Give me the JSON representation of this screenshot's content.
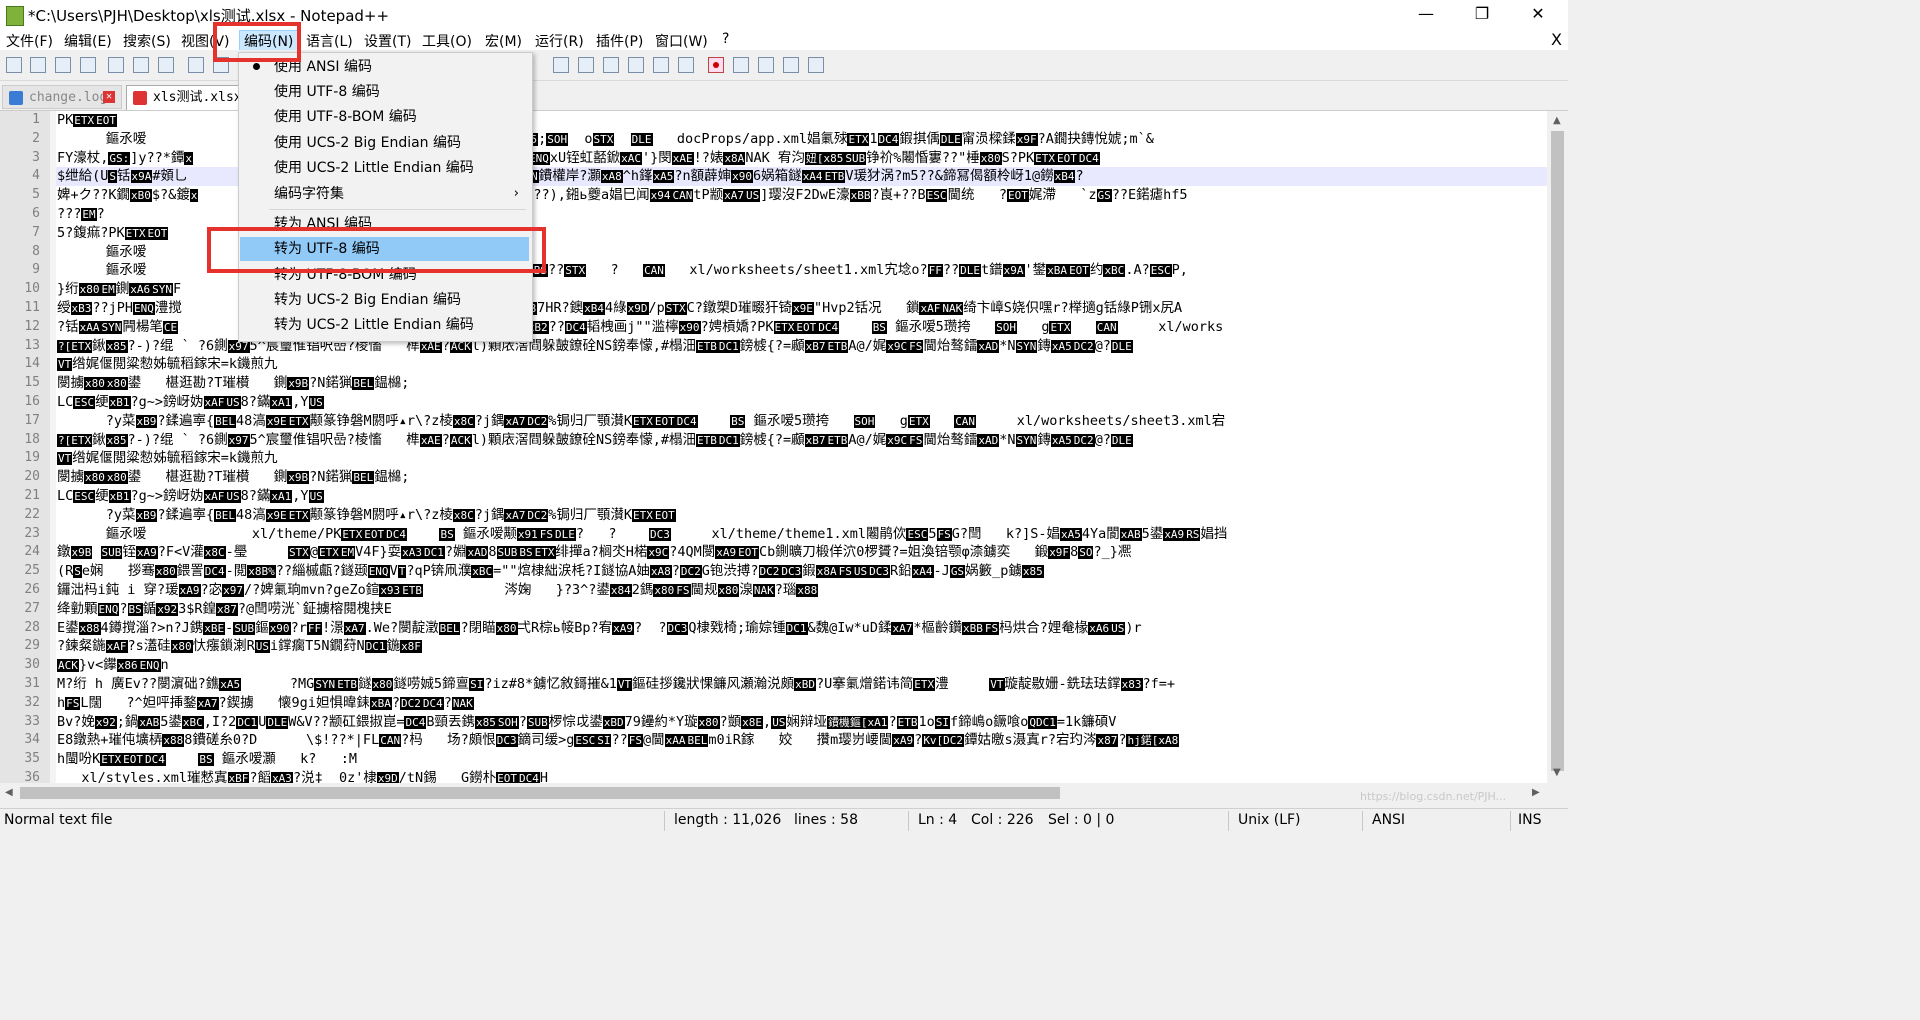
{
  "window": {
    "title": "*C:\\Users\\PJH\\Desktop\\xls测试.xlsx - Notepad++",
    "minimize": "—",
    "restore": "❐",
    "close": "✕"
  },
  "menubar": [
    "文件(F)",
    "编辑(E)",
    "搜索(S)",
    "视图(V)",
    "编码(N)",
    "语言(L)",
    "设置(T)",
    "工具(O)",
    "宏(M)",
    "运行(R)",
    "插件(P)",
    "窗口(W)",
    "?"
  ],
  "menubar_close": "X",
  "tabs": [
    {
      "label": "change.log",
      "active": false
    },
    {
      "label": "xls测试.xlsx",
      "active": true
    }
  ],
  "encoding_menu": {
    "items": [
      {
        "label": "使用 ANSI 编码",
        "checked": true
      },
      {
        "label": "使用 UTF-8 编码"
      },
      {
        "label": "使用 UTF-8-BOM 编码"
      },
      {
        "label": "使用 UCS-2 Big Endian 编码"
      },
      {
        "label": "使用 UCS-2 Little Endian 编码"
      },
      {
        "label": "编码字符集",
        "submenu": true
      },
      {
        "label": "转为 ANSI 编码"
      },
      {
        "label": "转为 UTF-8 编码",
        "highlighted": true
      },
      {
        "label": "转为 UTF-8-BOM 编码"
      },
      {
        "label": "转为 UCS-2 Big Endian 编码"
      },
      {
        "label": "转为 UCS-2 Little Endian 编码"
      }
    ],
    "submenu_arrow": "›"
  },
  "editor": {
    "line_numbers": [
      "1",
      "2",
      "3",
      "4",
      "5",
      "6",
      "7",
      "8",
      "9",
      "10",
      "11",
      "12",
      "13",
      "14",
      "15",
      "16",
      "17",
      "18",
      "19",
      "20",
      "21",
      "22",
      "23",
      "24",
      "25",
      "26",
      "27",
      "28",
      "29",
      "30",
      "31",
      "32",
      "33",
      "34",
      "35",
      "36"
    ],
    "current_line": 4,
    "lines": [
      "PK[ETX][EOT]",
      "      鏂氶嗳                                  [BS] 鏂氶嗳?y铮[xB5];[SOH]  o[STX]  [DLE]   docProps/app.xml娼氭殏[ETX]1[DC4]鍜掑偊[DLE]甯涢樑鍒[x9F]?A鐗抉鏄悅婋;m`&",
      "FY濠杖,[GS:]]y??*鐔[x]                        [A2]?v鐓眿闄[xAD]?宕   [ENQ]xU铚虹嚭鍁[xAC]'}閔[xAE]!?婊[x8A]NAK 宥汮[妞[x85][SUB]铮祄%闂惛寠??\"棰[x80]S?PK[ETX][EOT][DC4]",
      "$绁給(U[S]铦[x9A]#頞乚                               [SO]H娓佀斐挎[SYN]鐨權岸?灝[xA8]^h鎽[xA5]?n額薜婶[x90]6娲箱鐩[xA4][ETB]V瑗犲涡?m5??&鍗冩偈額柃岈1@鐒[xB4]?",
      "婢+ク??K鐗[xB0]$?&鍍[x]                            寚?X宕穇[FS]绠[x80]??),鎺ь夔a娼巳闻[x94][CAN]tP颛[xA7][US]]璎沒F2DwE濠[xBB]?崀+??B[ESC]閫统   ?[EOT]娓滯   `z[GS]??E鍩瘧hf5",
      "???[EM]?",
      "5?鍑痲?PK[ETX][EOT]",
      "      鏂氶嗳",
      "      鏂氶嗳                                  [DC4]   [BS] 鏂氶嗳[BS]??[STX]   ?   [CAN]   xl/worksheets/sheet1.xml宄埝o?[FF]??[DLE]t鐠[x9A]'鐢[xBA][EOT]约[xBC].A?[ESC]P,",
      "}绗[x80][EM]鍘[xA6][SYN]F                            氭發?c",
      "绶[xB3]??jPH[ENQ]澧搅                                |?闔[x97]?浣[xAB]7HR?鐭[xB4]4綠[x9D]/p[STX]C?鐓槊D璀畷犴锜[x9E]\"Hvp2铦况   鎖[xAF][NAK]绮卞嶂S娆伿嘿r?榉擿g铦綠P铏x尻A",
      "?铦[xAA][SYN]闁楊笔[CE]                             [34][BEL]~?倡   G颇[xB2]??[DC4]韬栧画j\"\"滥檸[x90]?娉槓嬌?PK[ETX][EOT][DC4]    [BS] 鏂氶嗳5瓒挎   [SOH]   g[ETX]   [CAN]     xl/works",
      "[?[ETX]鍬[x85]?-)?绲 ` ?6鍘[x97]5^宸璽倠锠呎嵒?棱慉   榫[xAE]?[ACK]l)顆庡滘閰躲皷鐐硂NS鎊奉懞,#榻沺[ETB][DC1]鎊榩{?=顣[xB7][ETB]A@/娓[x9C][FS]閫炲骜鐳[xAD]*N[SYN]鏄[xA5][DC2]@?[DLE]",
      "[VT]绺娓偃閲粱愸姊毓稻鎵宋=k鐖煎九",
      "閿擄[x80][x80]鍙   椹逛勘?T璀櫕   鍘[x9B]?N鍩猟[BEL]鎾檰;",
      "LC[ESC]绠[xB1]?g~>鎊岈妫[xAF][US]8?鏋[xA1],Y[US]",
      "      ?y菜[xB9]?鍒遍寕{[BEL]48滈[x9E][ETX]颟篆铮磐M閼呼▴r\\?z棱[x8C]?j鍝[xA7][DC2]%锔归厂顎濽K[ETX][EOT][DC4]    [BS] 鏂氶嗳5瓒挎   [SOH]   g[ETX]   [CAN]     xl/worksheets/sheet3.xml宕",
      "[?[ETX]鍬[x85]?-)?绲 ` ?6鍘[x97]5^宸璽倠锠呎嵒?棱慉   榫[xAE]?[ACK]l)顆庡滘閰躲皷鐐硂NS鎊奉懞,#榻沺[ETB][DC1]鎊榩{?=顣[xB7][ETB]A@/娓[x9C][FS]閫炲骜鐳[xAD]*N[SYN]鏄[xA5][DC2]@?[DLE]",
      "[VT]绺娓偃閲粱愸姊毓稻鎵宋=k鐖煎九",
      "閿擄[x80][x80]鍙   椹逛勘?T璀櫕   鍘[x9B]?N鍩猟[BEL]鎾檰;",
      "LC[ESC]绠[xB1]?g~>鎊岈妫[xAF][US]8?鏋[xA1],Y[US]",
      "      ?y菜[xB9]?鍒遍寕{[BEL]48滈[x9E][ETX]颟篆铮磐M閼呼▴r\\?z棱[x8C]?j鍝[xA7][DC2]%锔归厂顎濽K[ETX][EOT]",
      "      鏂氶嗳             xl/theme/PK[ETX][EOT][DC4]    [BS] 鏂氶嗳颟[x91][FS][DLE]?   ?    [DC3]     xl/theme/theme1.xml闂鹃佽[ESC]5[FS]G?閆   k?]S-娼[xA5]4Ya閬[xAB]5鍙[xA9][RS]娼挡",
      "鐓[x9B] [SUB]铚[xA9]?F<V灌[x8C]-璺     [STX]@[ETX][EM]V4F}耍[xA3][DC1]?婣[xAD]8[SUB][BS][ETX]绯撣a?榈氼H楉[x9C]?4QM閿[xA9][EOT]Cb鍘曠刀椴佯泬0椤贇?=姐渙锫颚φ渿鐪奕   鍛[x9F]8[SO]?_}凞",
      "(R[S]e娴   拶骞[x80]鍡詈[DC4]-閲[x8B%]??緇槭甗?鐩颋[ENQ]V[T]?qP锛凧濮[xBC]=\"\"熍棣絀涙枆?I鐩協A妯[xA8]?[DC2]G铇渋搏?[DC2][DC3]鍜[x8A][FS][US][DC3]R鉛[xA4]-J[GS]娲籔_p鐪[x85]",
      "鑼泏杩i鈍 i 穿?瑗[xA9]?宓[x97]/?婢氭珦mvn?geZo鍹[x93][ETB]          涔婅   }?3^?鍙[x84]2鎷[x80][FS]閫规[x80]湶[NAK]?瑙[x88]",
      "绛勭顆[ENQ]?[BS]鍎[x92]3$R鍠[x87]?@閆唠洸`鉦擄榕閱槐挟E",
      "E鍙[x88]4鐏撹淄?>n?J鎸[xBE]-[SUB]鏂[x90]?r[FF]!澋[xA7].We?閿靛澂[BEL]?閉瞄[x80]弌R棕ь帹Bp?宥[xA9]?  ?[DC3]Q棣戣椅;瑜婃锺[DC1]&魏@Iw*uD鍒[xA7]*樞齡鑽[xBB][FS]杩烘合?娌奙椽[xA6][US])r",
      "?鍊粲鍦[xAF]?s濭硅[x80]忕瘬鎖溂R[US]i鐣瘸T5N鐗荮N[DC1]鍦[x8F]",
      "[ACK]}v<鑻[x86][ENQ]n",
      "M?绗 h 廣Ev??閿濵础?鐎[xA5]      ?MG[SYN][ETB]鐩[x80]鐩唠娍5鍗亶[SI]?iz#8*鐪忆敘鎶摧&1[VT]鏂硅拶鑱狀惈鐮风瀬瀚涚頗[xBD]?U搴氭熷鍩讳简[ETX]澧     [VT]璇靛敭姗-銑珐珐鐣[x83]?f=+",
      "h[FS]L闊   ?^妲呯挿鍪[xA7]?鍥擄   懐9gi妲惧暐銇[xBA]?[DC2][DC4]?[NAK]",
      "Bv?娩[x92];鍋[xAB]5鍙[xBC],I?2[DC1]U[DLE]W&V??颛矼鍡掓崑=[DC4]B頸丟鎸[x85][SOH]?[SUB]椤悰戉鍙[xBD]79鑸約*Y璇[x80]?顗[x8E],[US]娴辩垭[鐨機鏂[xA1]?[ETB]1o[SI]f鍗嶋o鐝喰o[QDC1]=1k鐮碩V",
      "E8鐓熱+璀伅壙梇[x88]8鐨磋糸0?D      \\$!??*|FL[CAN]?杩   场?頗恨[DC3]鏑司缓>g[ESC][SI]??[FS]@閫[xAA][BEL]m0iR鎵   姣   攢m璎岃崾閫[xA9]?[Kv[DC2]鐔姑曒s滠寘r?宕玓涔[x87]?[hj鍩[xA8]",
      "h閩吩K[ETX][EOT][DC4]    [BS] 鏂氶嗳灝   k?   :M",
      "   xl/styles.xml璀慭寘[xBF]?饀[xA3]?涚‡  0z'棣[x9D]/tN錫   G鐒朴[EOT][DC4]H"
    ]
  },
  "statusbar": {
    "type": "Normal text file",
    "length": "length : 11,026",
    "lines": "lines : 58",
    "ln": "Ln : 4",
    "col": "Col : 226",
    "sel": "Sel : 0 | 0",
    "eol": "Unix (LF)",
    "encoding": "ANSI",
    "mode": "INS"
  },
  "watermark": "https://blog.csdn.net/PJH..."
}
